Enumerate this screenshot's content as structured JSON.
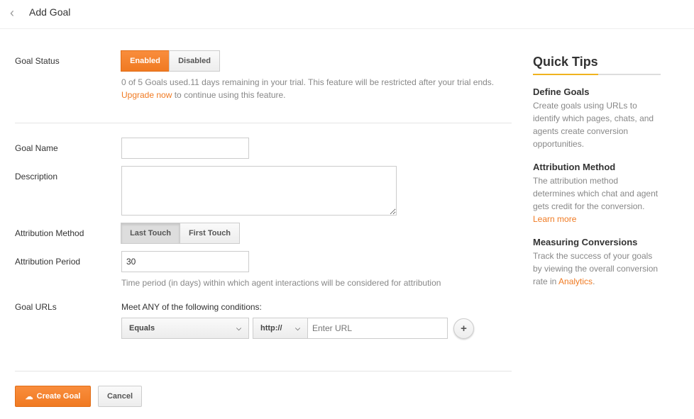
{
  "header": {
    "title": "Add Goal",
    "back_icon": "chevron-left-icon"
  },
  "goal_status": {
    "label": "Goal Status",
    "enabled": "Enabled",
    "disabled": "Disabled",
    "selected": "Enabled",
    "help": "0 of 5 Goals used.11 days remaining in your trial. This feature will be restricted after your trial ends.",
    "upgrade_link": "Upgrade now",
    "help_suffix": " to continue using this feature."
  },
  "goal_name": {
    "label": "Goal Name",
    "value": ""
  },
  "description": {
    "label": "Description",
    "value": ""
  },
  "attribution_method": {
    "label": "Attribution Method",
    "last": "Last Touch",
    "first": "First Touch",
    "selected": "Last Touch"
  },
  "attribution_period": {
    "label": "Attribution Period",
    "value": "30",
    "help": "Time period (in days) within which agent interactions will be considered for attribution"
  },
  "goal_urls": {
    "label": "Goal URLs",
    "intro": "Meet ANY of the following conditions:",
    "condition": "Equals",
    "protocol": "http://",
    "url_placeholder": "Enter URL",
    "add": "+"
  },
  "actions": {
    "create": "Create Goal",
    "cancel": "Cancel"
  },
  "tips": {
    "title": "Quick Tips",
    "items": [
      {
        "heading": "Define Goals",
        "body": "Create goals using URLs to identify which pages, chats, and agents create conversion opportunities."
      },
      {
        "heading": "Attribution Method",
        "body": "The attribution method determines which chat and agent gets credit for the conversion.",
        "link": "Learn more"
      },
      {
        "heading": "Measuring Conversions",
        "body": "Track the success of your goals by viewing the overall conversion rate in ",
        "link": "Analytics",
        "suffix": "."
      }
    ]
  },
  "colors": {
    "accent": "#f07a22",
    "tips_underline": "#f0b31e"
  }
}
